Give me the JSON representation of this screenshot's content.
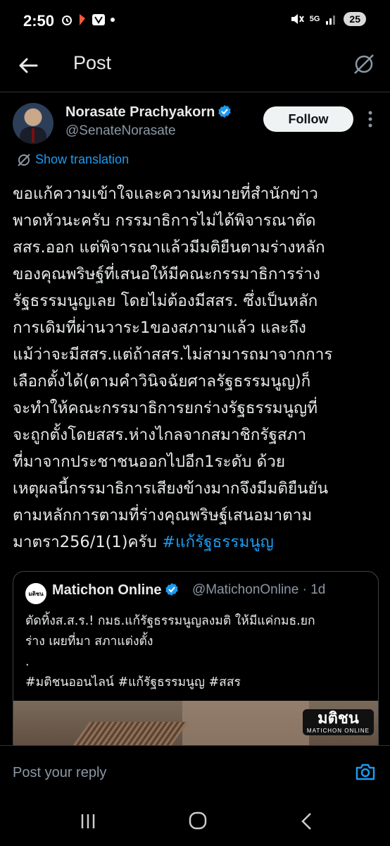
{
  "status_bar": {
    "time": "2:50",
    "network": "5G",
    "battery": "25"
  },
  "header": {
    "title": "Post"
  },
  "author": {
    "display_name": "Norasate Prachyakorn",
    "handle": "@SenateNorasate",
    "follow_label": "Follow"
  },
  "show_translation": "Show translation",
  "post": {
    "text": "ขอแก้ความเข้าใจและความหมายที่สำนักข่าว\nพาดหัวนะครับ กรรมาธิการไม่ได้พิจารณาตัด\nสสร.ออก แต่พิจารณาแล้วมีมติยืนตามร่างหลัก\nของคุณพริษฐ์ที่เสนอให้มีคณะกรรมาธิการร่าง\nรัฐธรรมนูญเลย โดยไม่ต้องมีสสร. ซึ่งเป็นหลัก\nการเดิมที่ผ่านวาระ1ของสภามาแล้ว และถึง\nแม้ว่าจะมีสสร.แต่ถ้าสสร.ไม่สามารถมาจากการ\nเลือกตั้งได้(ตามคำวินิจฉัยศาลรัฐธรรมนูญ)ก็\nจะทำให้คณะกรรมาธิการยกร่างรัฐธรรมนูญที่\nจะถูกตั้งโดยสสร.ห่างไกลจากสมาชิกรัฐสภา\nที่มาจากประชาชนออกไปอีก1ระดับ ด้วย\nเหตุผลนี้กรรมาธิการเสียงข้างมากจึงมีมติยืนยัน\nตามหลักการตามที่ร่างคุณพริษฐ์เสนอมาตาม\nมาตรา256/1(1)ครับ ",
    "hashtag": "#แก้รัฐธรรมนูญ"
  },
  "quote": {
    "avatar_text": "มติชน",
    "name": "Matichon Online",
    "handle": "@MatichonOnline · 1d",
    "text": "ตัดทิ้งส.ส.ร.! กมธ.แก้รัฐธรรมนูญลงมติ ให้มีแค่กมธ.ยก\nร่าง เผยที่มา สภาแต่งตั้ง\n.\n#มติชนออนไลน์ #แก้รัฐธรรมนูญ #สสร",
    "image_logo": "มติชน",
    "image_logo_sub": "MATICHON ONLINE"
  },
  "reply": {
    "placeholder": "Post your reply"
  },
  "colors": {
    "accent": "#1d9bf0",
    "background": "#000000",
    "text": "#e7e9ea",
    "muted": "#8b98a5"
  },
  "icons": [
    "back-arrow-icon",
    "no-translate-icon",
    "verified-badge-icon",
    "more-vertical-icon",
    "translate-icon",
    "camera-icon",
    "nav-recents-icon",
    "nav-home-icon",
    "nav-back-icon"
  ]
}
